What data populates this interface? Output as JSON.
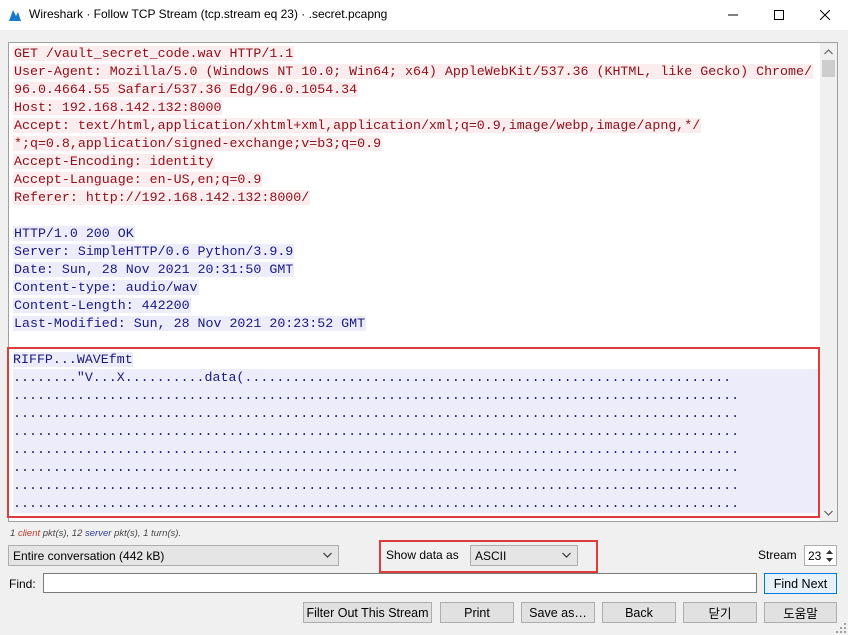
{
  "window": {
    "title": "Wireshark · Follow TCP Stream (tcp.stream eq 23) · .secret.pcapng"
  },
  "stream": {
    "client_lines": [
      "GET /vault_secret_code.wav HTTP/1.1",
      "User-Agent: Mozilla/5.0 (Windows NT 10.0; Win64; x64) AppleWebKit/537.36 (KHTML, like Gecko) Chrome/",
      "96.0.4664.55 Safari/537.36 Edg/96.0.1054.34",
      "Host: 192.168.142.132:8000",
      "Accept: text/html,application/xhtml+xml,application/xml;q=0.9,image/webp,image/apng,*/",
      "*;q=0.8,application/signed-exchange;v=b3;q=0.9",
      "Accept-Encoding: identity",
      "Accept-Language: en-US,en;q=0.9",
      "Referer: http://192.168.142.132:8000/"
    ],
    "server_lines": [
      "HTTP/1.0 200 OK",
      "Server: SimpleHTTP/0.6 Python/3.9.9",
      "Date: Sun, 28 Nov 2021 20:31:50 GMT",
      "Content-type: audio/wav",
      "Content-Length: 442200",
      "Last-Modified: Sun, 28 Nov 2021 20:23:52 GMT"
    ],
    "data_lines": [
      "RIFFP...WAVEfmt",
      "........\"V...X..........data(.............................................................",
      "...........................................................................................",
      "...........................................................................................",
      "...........................................................................................",
      "...........................................................................................",
      "...........................................................................................",
      "...........................................................................................",
      "..........................................................................................."
    ]
  },
  "stats": {
    "client_count": "1",
    "client_word": "client",
    "mid1": "pkt(s), 12",
    "server_word": "server",
    "mid2": "pkt(s), 1 turn(s)."
  },
  "controls": {
    "conversation": "Entire conversation (442 kB)",
    "show_data_label": "Show data as",
    "show_data_value": "ASCII",
    "stream_label": "Stream",
    "stream_value": "23",
    "find_label": "Find:",
    "find_value": "",
    "find_next": "Find Next"
  },
  "buttons": {
    "filter_out": "Filter Out This Stream",
    "print": "Print",
    "save_as": "Save as…",
    "back": "Back",
    "close": "닫기",
    "help": "도움말"
  },
  "colors": {
    "client_fg": "#8e0f1c",
    "client_bg": "#fbeded",
    "server_fg": "#1a1a80",
    "server_bg": "#ececfa",
    "highlight": "#e03b3b"
  }
}
